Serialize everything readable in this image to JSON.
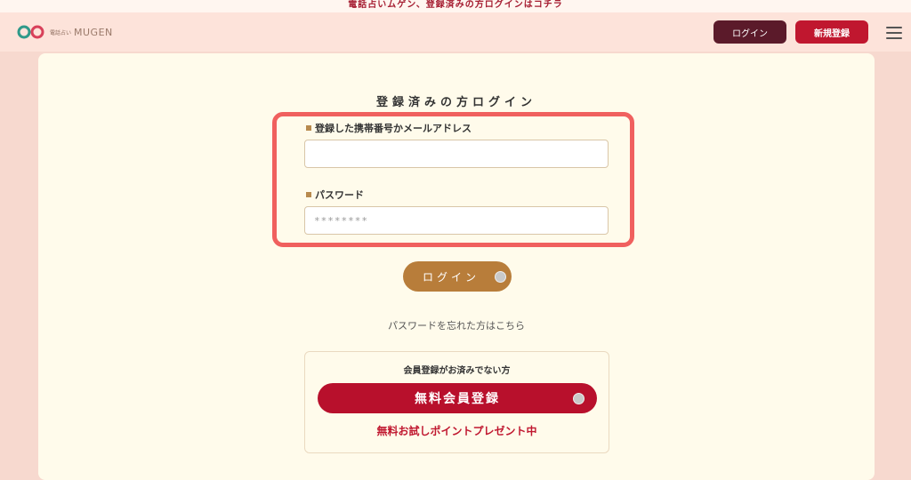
{
  "top_banner": "電話占いムゲン、登録済みの方ログインはコチラ",
  "header": {
    "logo_small": "電話占い",
    "logo_text": "MUGEN",
    "login_button": "ログイン",
    "register_button": "新規登録"
  },
  "login_form": {
    "title": "登録済みの方ログイン",
    "identifier_label": "登録した携帯番号かメールアドレス",
    "identifier_value": "",
    "password_label": "パスワード",
    "password_value": "********",
    "submit_label": "ログイン",
    "forgot_link": "パスワードを忘れた方はこちら"
  },
  "register_box": {
    "question": "会員登録がお済みでない方",
    "button_label": "無料会員登録",
    "promo": "無料お試しポイントプレゼント中"
  },
  "colors": {
    "accent_red": "#c0172f",
    "dark_wine": "#5b1a2a",
    "gold": "#b87d3a",
    "highlight": "#f0605e"
  }
}
